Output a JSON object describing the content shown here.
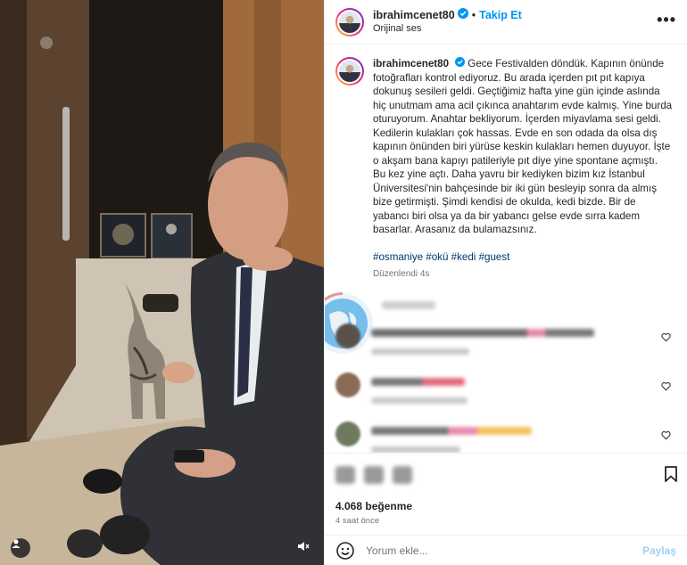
{
  "header": {
    "username": "ibrahimcenet80",
    "dot": "•",
    "follow_label": "Takip Et",
    "audio_label": "Orijinal ses",
    "more_label": "•••"
  },
  "caption": {
    "username": "ibrahimcenet80",
    "text": "Gece Festivalden döndük. Kapının önünde fotoğrafları kontrol ediyoruz. Bu arada içerden pıt pıt kapıya dokunuş sesileri geldi. Geçtiğimiz hafta yine gün içinde aslında hiç unutmam ama acil çıkınca anahtarım evde kalmış. Yine burda oturuyorum. Anahtar bekliyorum. İçerden miyavlama sesi geldi. Kedilerin kulakları çok hassas. Evde en son odada da olsa dış kapının önünden biri yürüse keskin kulakları hemen duyuyor. İşte o akşam bana kapıyı patileriyle pıt diye yine spontane açmıştı. Bu kez yine açtı. Daha yavru bir kediyken bizim kız İstanbul Üniversitesi'nin bahçesinde bir iki gün besleyip sonra da almış bize getirmişti. Şimdi kendisi de okulda, kedi bizde. Bir de yabancı biri olsa ya da bir yabancı gelse evde sırra kadem basarlar. Arasanız da bulamazsınız.",
    "hashtags": "#osmaniye #okü #kedi #guest",
    "edited": "Düzenlendi",
    "edited_ago": "4s"
  },
  "actions": {
    "likes": "4.068 beğenme",
    "time_ago": "4 saat önce"
  },
  "add_comment": {
    "placeholder": "Yorum ekle...",
    "share_label": "Paylaş"
  },
  "colors": {
    "accent": "#0095f6",
    "verified": "#0095f6",
    "hashtag": "#00376b",
    "muted": "#737373"
  }
}
